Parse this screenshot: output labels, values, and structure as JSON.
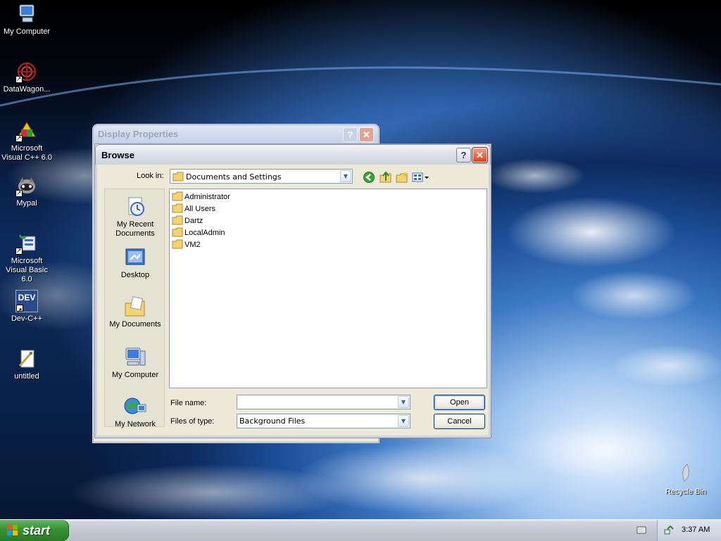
{
  "desktop": {
    "icons": [
      {
        "label": "My Computer",
        "icon": "my-computer-icon"
      },
      {
        "label": "DataWagon...",
        "icon": "datawagon-icon"
      },
      {
        "label": "Microsoft Visual C++ 6.0",
        "icon": "visual-cpp-icon"
      },
      {
        "label": "Mypal",
        "icon": "mypal-icon"
      },
      {
        "label": "Microsoft Visual Basic 6.0",
        "icon": "visual-basic-icon"
      },
      {
        "label": "Dev-C++",
        "icon": "dev-cpp-icon"
      },
      {
        "label": "untitled",
        "icon": "paint-file-icon"
      },
      {
        "label": "Recycle Bin",
        "icon": "recycle-bin-icon"
      }
    ],
    "dev_badge": "DEV"
  },
  "back_window": {
    "title": "Display Properties",
    "help_glyph": "?",
    "close_glyph": "✕"
  },
  "dialog": {
    "title": "Browse",
    "help_glyph": "?",
    "close_glyph": "✕",
    "look_in_label": "Look in:",
    "look_in_value": "Documents and Settings",
    "places": [
      {
        "label": "My Recent Documents",
        "icon": "recent-documents-icon"
      },
      {
        "label": "Desktop",
        "icon": "desktop-icon"
      },
      {
        "label": "My Documents",
        "icon": "my-documents-icon"
      },
      {
        "label": "My Computer",
        "icon": "my-computer-icon"
      },
      {
        "label": "My Network",
        "icon": "network-places-icon"
      }
    ],
    "files": [
      "Administrator",
      "All Users",
      "Dartz",
      "LocalAdmin",
      "VM2"
    ],
    "file_name_label": "File name:",
    "file_name_value": "",
    "files_of_type_label": "Files of type:",
    "files_of_type_value": "Background Files",
    "open_label": "Open",
    "cancel_label": "Cancel"
  },
  "taskbar": {
    "start_label": "start",
    "clock": "3:37 AM"
  },
  "colors": {
    "xp_blue": "#0831d9",
    "start_green": "#3a9336",
    "close_red": "#d4451f",
    "dialog_face": "#ece9d8"
  }
}
